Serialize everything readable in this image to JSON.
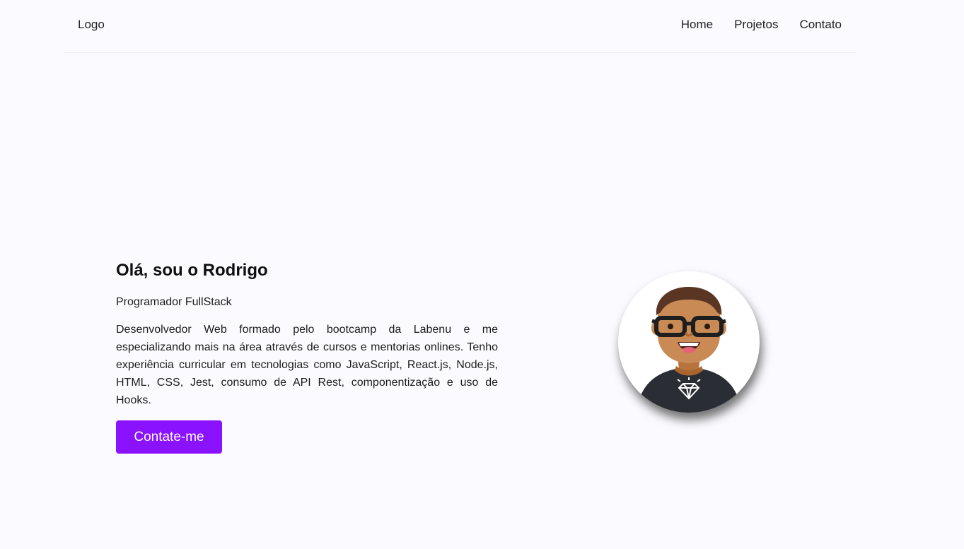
{
  "header": {
    "logo": "Logo",
    "nav": [
      "Home",
      "Projetos",
      "Contato"
    ]
  },
  "intro": {
    "title": "Olá, sou o Rodrigo",
    "role": "Programador FullStack",
    "bio": "Desenvolvedor Web formado pelo bootcamp da Labenu e me especializando mais na área através de cursos e mentorias onlines. Tenho experiência curricular em tecnologias como JavaScript, React.js, Node.js, HTML, CSS, Jest, consumo de API Rest, componentização e uso de Hooks.",
    "button_label": "Contate-me"
  },
  "avatar": {
    "icon": "avatar-icon"
  },
  "colors": {
    "background": "#fbfafe",
    "accent": "#8a12ff",
    "text": "#1c1c1c"
  }
}
